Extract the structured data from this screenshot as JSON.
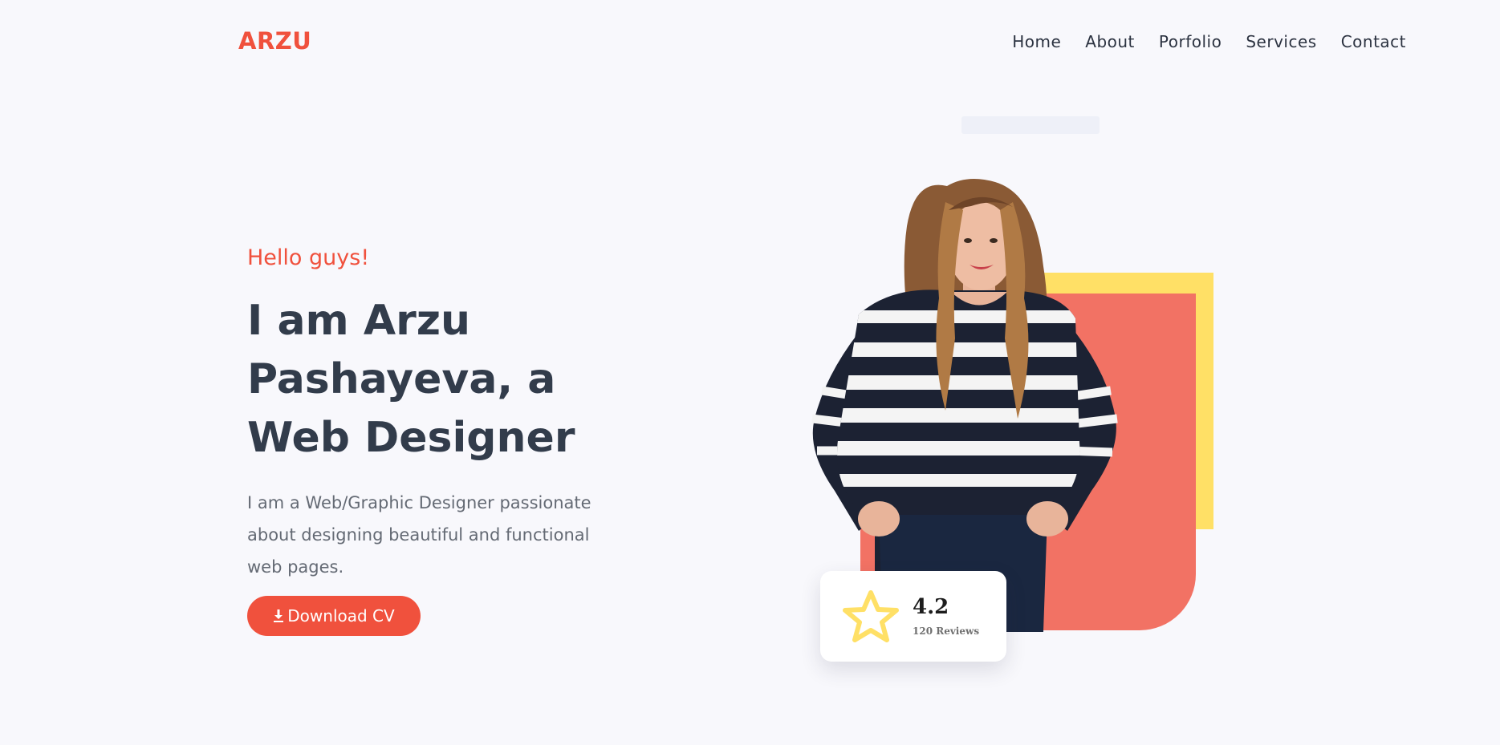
{
  "header": {
    "logo": "ARZU",
    "nav": [
      "Home",
      "About",
      "Porfolio",
      "Services",
      "Contact"
    ]
  },
  "hero": {
    "greeting": "Hello guys!",
    "headline": "I am Arzu Pashayeva, a Web Designer",
    "description": "I am a Web/Graphic Designer passionate about designing beautiful and functional web pages.",
    "download_label": "Download CV",
    "download_icon": "download-icon"
  },
  "rating": {
    "score": "4.2",
    "reviews": "120 Reviews",
    "icon": "star-icon"
  },
  "colors": {
    "accent": "#f0513d",
    "heading": "#323c4b",
    "body_text": "#646a74",
    "yellow_shape": "#ffe066",
    "red_shape": "#f27264",
    "star": "#ffe066"
  }
}
